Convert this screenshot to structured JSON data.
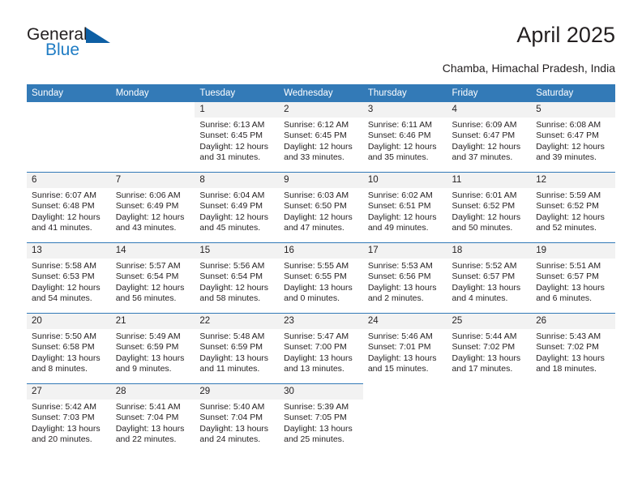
{
  "brand": {
    "name_part1": "General",
    "name_part2": "Blue",
    "accent_color": "#0e5fa4",
    "blue_text_color": "#1f7cc4"
  },
  "header": {
    "title": "April 2025",
    "subtitle": "Chamba, Himachal Pradesh, India"
  },
  "theme": {
    "header_bg": "#337ab7",
    "daynum_bg": "#f2f2f2",
    "row_divider": "#337ab7"
  },
  "calendar": {
    "weekday_headers": [
      "Sunday",
      "Monday",
      "Tuesday",
      "Wednesday",
      "Thursday",
      "Friday",
      "Saturday"
    ],
    "weeks": [
      [
        {
          "day": "",
          "empty": true,
          "sunrise": "",
          "sunset": "",
          "daylight": ""
        },
        {
          "day": "",
          "empty": true,
          "sunrise": "",
          "sunset": "",
          "daylight": ""
        },
        {
          "day": "1",
          "empty": false,
          "sunrise": "Sunrise: 6:13 AM",
          "sunset": "Sunset: 6:45 PM",
          "daylight": "Daylight: 12 hours and 31 minutes."
        },
        {
          "day": "2",
          "empty": false,
          "sunrise": "Sunrise: 6:12 AM",
          "sunset": "Sunset: 6:45 PM",
          "daylight": "Daylight: 12 hours and 33 minutes."
        },
        {
          "day": "3",
          "empty": false,
          "sunrise": "Sunrise: 6:11 AM",
          "sunset": "Sunset: 6:46 PM",
          "daylight": "Daylight: 12 hours and 35 minutes."
        },
        {
          "day": "4",
          "empty": false,
          "sunrise": "Sunrise: 6:09 AM",
          "sunset": "Sunset: 6:47 PM",
          "daylight": "Daylight: 12 hours and 37 minutes."
        },
        {
          "day": "5",
          "empty": false,
          "sunrise": "Sunrise: 6:08 AM",
          "sunset": "Sunset: 6:47 PM",
          "daylight": "Daylight: 12 hours and 39 minutes."
        }
      ],
      [
        {
          "day": "6",
          "empty": false,
          "sunrise": "Sunrise: 6:07 AM",
          "sunset": "Sunset: 6:48 PM",
          "daylight": "Daylight: 12 hours and 41 minutes."
        },
        {
          "day": "7",
          "empty": false,
          "sunrise": "Sunrise: 6:06 AM",
          "sunset": "Sunset: 6:49 PM",
          "daylight": "Daylight: 12 hours and 43 minutes."
        },
        {
          "day": "8",
          "empty": false,
          "sunrise": "Sunrise: 6:04 AM",
          "sunset": "Sunset: 6:49 PM",
          "daylight": "Daylight: 12 hours and 45 minutes."
        },
        {
          "day": "9",
          "empty": false,
          "sunrise": "Sunrise: 6:03 AM",
          "sunset": "Sunset: 6:50 PM",
          "daylight": "Daylight: 12 hours and 47 minutes."
        },
        {
          "day": "10",
          "empty": false,
          "sunrise": "Sunrise: 6:02 AM",
          "sunset": "Sunset: 6:51 PM",
          "daylight": "Daylight: 12 hours and 49 minutes."
        },
        {
          "day": "11",
          "empty": false,
          "sunrise": "Sunrise: 6:01 AM",
          "sunset": "Sunset: 6:52 PM",
          "daylight": "Daylight: 12 hours and 50 minutes."
        },
        {
          "day": "12",
          "empty": false,
          "sunrise": "Sunrise: 5:59 AM",
          "sunset": "Sunset: 6:52 PM",
          "daylight": "Daylight: 12 hours and 52 minutes."
        }
      ],
      [
        {
          "day": "13",
          "empty": false,
          "sunrise": "Sunrise: 5:58 AM",
          "sunset": "Sunset: 6:53 PM",
          "daylight": "Daylight: 12 hours and 54 minutes."
        },
        {
          "day": "14",
          "empty": false,
          "sunrise": "Sunrise: 5:57 AM",
          "sunset": "Sunset: 6:54 PM",
          "daylight": "Daylight: 12 hours and 56 minutes."
        },
        {
          "day": "15",
          "empty": false,
          "sunrise": "Sunrise: 5:56 AM",
          "sunset": "Sunset: 6:54 PM",
          "daylight": "Daylight: 12 hours and 58 minutes."
        },
        {
          "day": "16",
          "empty": false,
          "sunrise": "Sunrise: 5:55 AM",
          "sunset": "Sunset: 6:55 PM",
          "daylight": "Daylight: 13 hours and 0 minutes."
        },
        {
          "day": "17",
          "empty": false,
          "sunrise": "Sunrise: 5:53 AM",
          "sunset": "Sunset: 6:56 PM",
          "daylight": "Daylight: 13 hours and 2 minutes."
        },
        {
          "day": "18",
          "empty": false,
          "sunrise": "Sunrise: 5:52 AM",
          "sunset": "Sunset: 6:57 PM",
          "daylight": "Daylight: 13 hours and 4 minutes."
        },
        {
          "day": "19",
          "empty": false,
          "sunrise": "Sunrise: 5:51 AM",
          "sunset": "Sunset: 6:57 PM",
          "daylight": "Daylight: 13 hours and 6 minutes."
        }
      ],
      [
        {
          "day": "20",
          "empty": false,
          "sunrise": "Sunrise: 5:50 AM",
          "sunset": "Sunset: 6:58 PM",
          "daylight": "Daylight: 13 hours and 8 minutes."
        },
        {
          "day": "21",
          "empty": false,
          "sunrise": "Sunrise: 5:49 AM",
          "sunset": "Sunset: 6:59 PM",
          "daylight": "Daylight: 13 hours and 9 minutes."
        },
        {
          "day": "22",
          "empty": false,
          "sunrise": "Sunrise: 5:48 AM",
          "sunset": "Sunset: 6:59 PM",
          "daylight": "Daylight: 13 hours and 11 minutes."
        },
        {
          "day": "23",
          "empty": false,
          "sunrise": "Sunrise: 5:47 AM",
          "sunset": "Sunset: 7:00 PM",
          "daylight": "Daylight: 13 hours and 13 minutes."
        },
        {
          "day": "24",
          "empty": false,
          "sunrise": "Sunrise: 5:46 AM",
          "sunset": "Sunset: 7:01 PM",
          "daylight": "Daylight: 13 hours and 15 minutes."
        },
        {
          "day": "25",
          "empty": false,
          "sunrise": "Sunrise: 5:44 AM",
          "sunset": "Sunset: 7:02 PM",
          "daylight": "Daylight: 13 hours and 17 minutes."
        },
        {
          "day": "26",
          "empty": false,
          "sunrise": "Sunrise: 5:43 AM",
          "sunset": "Sunset: 7:02 PM",
          "daylight": "Daylight: 13 hours and 18 minutes."
        }
      ],
      [
        {
          "day": "27",
          "empty": false,
          "sunrise": "Sunrise: 5:42 AM",
          "sunset": "Sunset: 7:03 PM",
          "daylight": "Daylight: 13 hours and 20 minutes."
        },
        {
          "day": "28",
          "empty": false,
          "sunrise": "Sunrise: 5:41 AM",
          "sunset": "Sunset: 7:04 PM",
          "daylight": "Daylight: 13 hours and 22 minutes."
        },
        {
          "day": "29",
          "empty": false,
          "sunrise": "Sunrise: 5:40 AM",
          "sunset": "Sunset: 7:04 PM",
          "daylight": "Daylight: 13 hours and 24 minutes."
        },
        {
          "day": "30",
          "empty": false,
          "sunrise": "Sunrise: 5:39 AM",
          "sunset": "Sunset: 7:05 PM",
          "daylight": "Daylight: 13 hours and 25 minutes."
        },
        {
          "day": "",
          "empty": true,
          "sunrise": "",
          "sunset": "",
          "daylight": ""
        },
        {
          "day": "",
          "empty": true,
          "sunrise": "",
          "sunset": "",
          "daylight": ""
        },
        {
          "day": "",
          "empty": true,
          "sunrise": "",
          "sunset": "",
          "daylight": ""
        }
      ]
    ]
  }
}
